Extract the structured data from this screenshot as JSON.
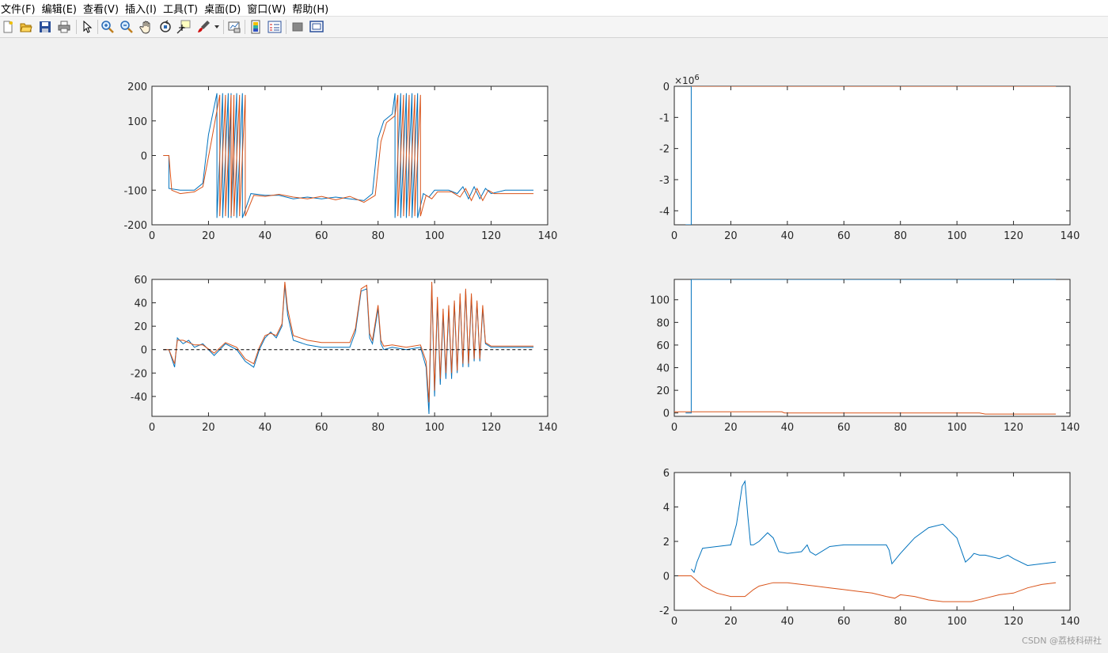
{
  "menubar": {
    "items": [
      "文件(F)",
      "编辑(E)",
      "查看(V)",
      "插入(I)",
      "工具(T)",
      "桌面(D)",
      "窗口(W)",
      "帮助(H)"
    ]
  },
  "toolbar": {
    "buttons": [
      "new-figure",
      "open-file",
      "save",
      "print",
      "edit-plot",
      "zoom-in",
      "zoom-out",
      "pan",
      "rotate-3d",
      "data-cursor",
      "brush",
      "link-plot",
      "insert-colorbar",
      "insert-legend",
      "hide-plot-tools",
      "show-plot-tools"
    ]
  },
  "colors": {
    "series1": "#0072BD",
    "series2": "#D95319",
    "reference": "#000000"
  },
  "watermark": "CSDN @荔枝科研社",
  "chart_data": [
    {
      "type": "line",
      "xlim": [
        0,
        140
      ],
      "ylim": [
        -200,
        200
      ],
      "yticks": [
        -200,
        -100,
        0,
        100,
        200
      ],
      "xticks": [
        0,
        20,
        40,
        60,
        80,
        100,
        120,
        140
      ],
      "series": [
        {
          "x": [
            4,
            6,
            6,
            10,
            15,
            18,
            20,
            23,
            23,
            25,
            25,
            27,
            27,
            28,
            28,
            30,
            30,
            32,
            32,
            35,
            40,
            45,
            50,
            55,
            60,
            65,
            70,
            75,
            78,
            80,
            82,
            85,
            86,
            86,
            88,
            88,
            90,
            90,
            92,
            92,
            94,
            94,
            96,
            98,
            100,
            105,
            108,
            110,
            112,
            114,
            116,
            118,
            120,
            125,
            130,
            135
          ],
          "y": [
            0,
            0,
            -95,
            -100,
            -100,
            -80,
            60,
            180,
            -180,
            180,
            -180,
            180,
            -180,
            180,
            -180,
            180,
            -180,
            180,
            -180,
            -110,
            -115,
            -115,
            -125,
            -120,
            -125,
            -120,
            -125,
            -130,
            -110,
            50,
            100,
            120,
            180,
            -180,
            180,
            -180,
            180,
            -180,
            180,
            -180,
            180,
            -180,
            -110,
            -120,
            -100,
            -100,
            -110,
            -90,
            -125,
            -90,
            -125,
            -95,
            -110,
            -100,
            -100,
            -100
          ]
        },
        {
          "x": [
            4,
            6,
            7,
            10,
            15,
            18,
            21,
            24,
            24,
            26,
            26,
            28,
            28,
            29,
            29,
            31,
            31,
            33,
            33,
            36,
            40,
            45,
            50,
            55,
            60,
            65,
            70,
            75,
            79,
            81,
            83,
            86,
            87,
            87,
            89,
            89,
            91,
            91,
            93,
            93,
            95,
            95,
            97,
            99,
            101,
            106,
            109,
            111,
            113,
            115,
            117,
            119,
            121,
            125,
            130,
            135
          ],
          "y": [
            0,
            0,
            -100,
            -110,
            -105,
            -90,
            40,
            175,
            -175,
            175,
            -175,
            175,
            -175,
            175,
            -175,
            175,
            -175,
            175,
            -175,
            -115,
            -118,
            -112,
            -120,
            -125,
            -118,
            -128,
            -118,
            -135,
            -115,
            40,
            95,
            115,
            175,
            -175,
            175,
            -175,
            175,
            -175,
            175,
            -175,
            175,
            -175,
            -115,
            -125,
            -105,
            -105,
            -120,
            -95,
            -130,
            -95,
            -130,
            -100,
            -110,
            -110,
            -110,
            -110
          ]
        }
      ]
    },
    {
      "type": "line",
      "xlim": [
        0,
        140
      ],
      "ylim": [
        -4.45,
        0
      ],
      "yticks": [
        -4,
        -3,
        -2,
        -1,
        0
      ],
      "xticks": [
        0,
        20,
        40,
        60,
        80,
        100,
        120,
        140
      ],
      "exponent_label": "×10",
      "exponent_power": "6",
      "series": [
        {
          "x": [
            4,
            6,
            6,
            135
          ],
          "y": [
            -4.45,
            -4.45,
            0,
            0
          ]
        },
        {
          "x": [
            6,
            135
          ],
          "y": [
            0,
            0
          ]
        }
      ]
    },
    {
      "type": "line",
      "xlim": [
        0,
        140
      ],
      "ylim": [
        -57,
        60
      ],
      "yticks": [
        -40,
        -20,
        0,
        20,
        40,
        60
      ],
      "xticks": [
        0,
        20,
        40,
        60,
        80,
        100,
        120,
        140
      ],
      "series": [
        {
          "x": [
            4,
            6,
            8,
            9,
            11,
            13,
            15,
            18,
            22,
            26,
            30,
            33,
            36,
            38,
            40,
            42,
            44,
            46,
            47,
            48,
            50,
            55,
            60,
            65,
            70,
            72,
            74,
            76,
            77,
            78,
            80,
            81,
            82,
            85,
            90,
            95,
            97,
            98,
            99,
            100,
            101,
            102,
            103,
            104,
            105,
            106,
            107,
            108,
            109,
            110,
            111,
            112,
            113,
            114,
            115,
            116,
            117,
            118,
            120,
            125,
            130,
            135
          ],
          "y": [
            0,
            0,
            -15,
            10,
            5,
            8,
            2,
            5,
            -5,
            5,
            0,
            -10,
            -15,
            0,
            10,
            15,
            10,
            20,
            55,
            30,
            8,
            4,
            2,
            2,
            2,
            15,
            50,
            52,
            10,
            5,
            35,
            5,
            0,
            2,
            0,
            2,
            -15,
            -55,
            55,
            -40,
            40,
            -30,
            30,
            -25,
            35,
            -25,
            40,
            -20,
            45,
            -15,
            50,
            -15,
            45,
            -10,
            40,
            -10,
            35,
            5,
            2,
            2,
            2,
            2
          ]
        },
        {
          "x": [
            4,
            6,
            8,
            9,
            11,
            13,
            15,
            18,
            22,
            26,
            30,
            33,
            36,
            38,
            40,
            42,
            44,
            46,
            47,
            48,
            50,
            55,
            60,
            65,
            70,
            72,
            74,
            76,
            77,
            78,
            80,
            81,
            82,
            85,
            90,
            95,
            97,
            98,
            99,
            100,
            101,
            102,
            103,
            104,
            105,
            106,
            107,
            108,
            109,
            110,
            111,
            112,
            113,
            114,
            115,
            116,
            117,
            118,
            120,
            125,
            130,
            135
          ],
          "y": [
            0,
            0,
            -12,
            8,
            8,
            6,
            4,
            4,
            -3,
            6,
            2,
            -8,
            -12,
            2,
            12,
            14,
            12,
            22,
            58,
            35,
            12,
            8,
            6,
            6,
            6,
            18,
            52,
            55,
            14,
            8,
            38,
            8,
            3,
            4,
            2,
            4,
            -10,
            -45,
            58,
            -35,
            45,
            -25,
            35,
            -20,
            38,
            -20,
            42,
            -18,
            48,
            -12,
            52,
            -12,
            48,
            -8,
            42,
            -8,
            38,
            6,
            3,
            3,
            3,
            3
          ]
        },
        {
          "x": [
            4,
            135
          ],
          "y": [
            0,
            0
          ],
          "dashed": true
        }
      ]
    },
    {
      "type": "line",
      "xlim": [
        0,
        140
      ],
      "ylim": [
        -3,
        118
      ],
      "yticks": [
        0,
        20,
        40,
        60,
        80,
        100
      ],
      "xticks": [
        0,
        20,
        40,
        60,
        80,
        100,
        120,
        140
      ],
      "series": [
        {
          "x": [
            4,
            6,
            6,
            135
          ],
          "y": [
            0,
            0,
            118,
            118
          ]
        },
        {
          "x": [
            0,
            38,
            39,
            108,
            110,
            135
          ],
          "y": [
            1,
            1,
            0,
            0,
            -1,
            -1
          ]
        }
      ]
    },
    {
      "type": "line",
      "xlim": [
        0,
        140
      ],
      "ylim": [
        -2,
        6
      ],
      "yticks": [
        -2,
        0,
        2,
        4,
        6
      ],
      "xticks": [
        0,
        20,
        40,
        60,
        80,
        100,
        120,
        140
      ],
      "series": [
        {
          "x": [
            6,
            7,
            8,
            10,
            15,
            20,
            22,
            24,
            25,
            26,
            27,
            28,
            30,
            33,
            35,
            37,
            40,
            45,
            47,
            48,
            50,
            55,
            60,
            65,
            70,
            75,
            76,
            77,
            80,
            85,
            90,
            95,
            100,
            103,
            105,
            106,
            108,
            110,
            115,
            118,
            120,
            125,
            130,
            135
          ],
          "y": [
            0.4,
            0.2,
            0.8,
            1.6,
            1.7,
            1.8,
            3.0,
            5.2,
            5.5,
            3.5,
            1.8,
            1.8,
            2.0,
            2.5,
            2.2,
            1.4,
            1.3,
            1.4,
            1.8,
            1.4,
            1.2,
            1.7,
            1.8,
            1.8,
            1.8,
            1.8,
            1.5,
            0.7,
            1.3,
            2.2,
            2.8,
            3.0,
            2.2,
            0.8,
            1.1,
            1.3,
            1.2,
            1.2,
            1.0,
            1.2,
            1.0,
            0.6,
            0.7,
            0.8
          ]
        },
        {
          "x": [
            0,
            5,
            6,
            8,
            10,
            15,
            20,
            25,
            28,
            30,
            35,
            40,
            45,
            50,
            55,
            60,
            65,
            70,
            75,
            78,
            80,
            85,
            90,
            95,
            100,
            105,
            110,
            115,
            120,
            125,
            130,
            135
          ],
          "y": [
            0,
            0,
            0,
            -0.3,
            -0.6,
            -1.0,
            -1.2,
            -1.2,
            -0.8,
            -0.6,
            -0.4,
            -0.4,
            -0.5,
            -0.6,
            -0.7,
            -0.8,
            -0.9,
            -1.0,
            -1.2,
            -1.3,
            -1.1,
            -1.2,
            -1.4,
            -1.5,
            -1.5,
            -1.5,
            -1.3,
            -1.1,
            -1.0,
            -0.7,
            -0.5,
            -0.4
          ]
        }
      ]
    }
  ]
}
